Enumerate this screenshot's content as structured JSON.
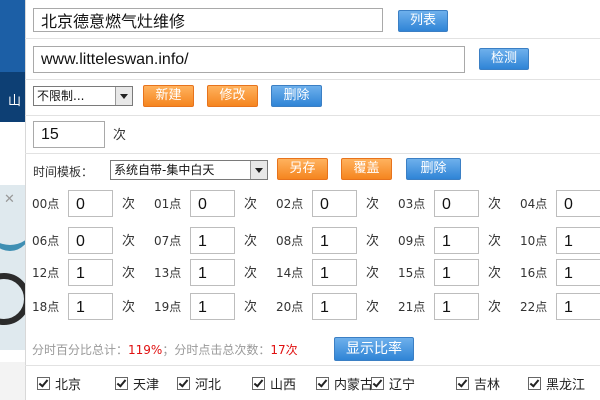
{
  "task": {
    "name_value": "北京德意燃气灶维修",
    "list_label": "列表"
  },
  "url": {
    "value": "www.litteleswan.info/",
    "check_label": "检测"
  },
  "limit": {
    "selected": "不限制...",
    "new_label": "新建",
    "edit_label": "修改",
    "delete_label": "删除"
  },
  "count": {
    "value": "15",
    "unit": "次"
  },
  "template": {
    "label": "时间模板：",
    "selected": "系统自带-集中白天",
    "save_as_label": "另存",
    "overwrite_label": "覆盖",
    "delete_label": "删除"
  },
  "hours": [
    {
      "label": "00点",
      "value": "0"
    },
    {
      "label": "01点",
      "value": "0"
    },
    {
      "label": "02点",
      "value": "0"
    },
    {
      "label": "03点",
      "value": "0"
    },
    {
      "label": "04点",
      "value": "0"
    },
    {
      "label": "06点",
      "value": "0"
    },
    {
      "label": "07点",
      "value": "1"
    },
    {
      "label": "08点",
      "value": "1"
    },
    {
      "label": "09点",
      "value": "1"
    },
    {
      "label": "10点",
      "value": "1"
    },
    {
      "label": "12点",
      "value": "1"
    },
    {
      "label": "13点",
      "value": "1"
    },
    {
      "label": "14点",
      "value": "1"
    },
    {
      "label": "15点",
      "value": "1"
    },
    {
      "label": "16点",
      "value": "1"
    },
    {
      "label": "18点",
      "value": "1"
    },
    {
      "label": "19点",
      "value": "1"
    },
    {
      "label": "20点",
      "value": "1"
    },
    {
      "label": "21点",
      "value": "1"
    },
    {
      "label": "22点",
      "value": "1"
    }
  ],
  "hour_unit": "次",
  "stats": {
    "percent_label": "分时百分比总计：",
    "percent_value": "119%",
    "sep_label": "；分时点击总次数：",
    "clicks_value": "17次",
    "show_ratio_label": "显示比率"
  },
  "provinces": [
    "北京",
    "天津",
    "河北",
    "山西",
    "内蒙古",
    "辽宁",
    "吉林",
    "黑龙江"
  ],
  "sidebar": {
    "char": "山",
    "close": "✕"
  }
}
